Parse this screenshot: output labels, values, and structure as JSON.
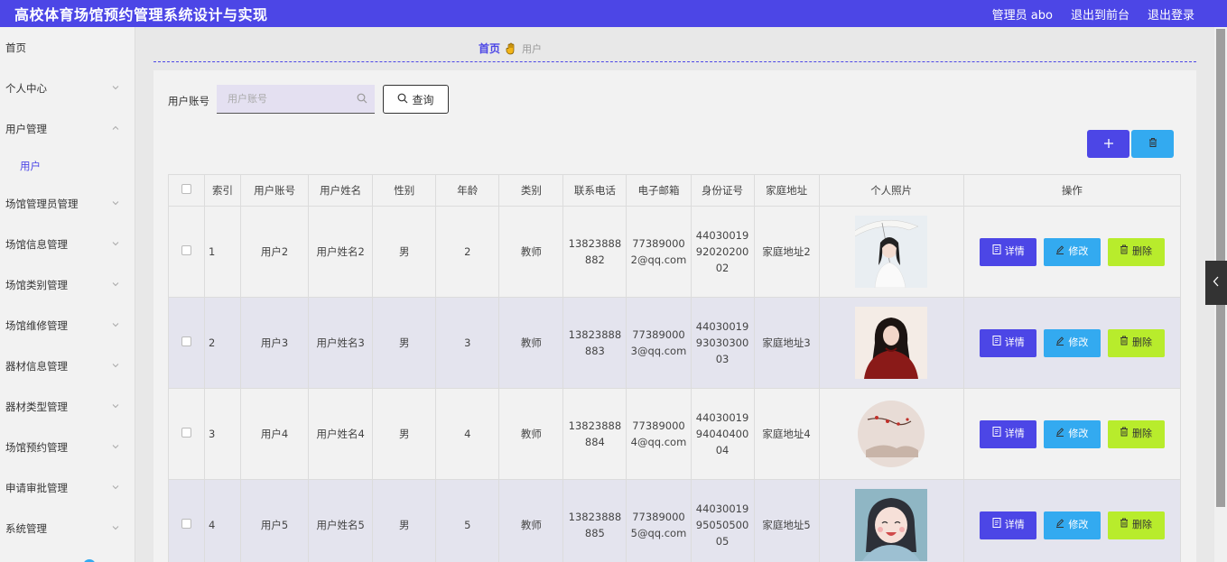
{
  "header": {
    "title": "高校体育场馆预约管理系统设计与实现",
    "admin": "管理员 abo",
    "back_to_front": "退出到前台",
    "logout": "退出登录"
  },
  "sidebar": {
    "items": [
      {
        "label": "首页",
        "expandable": false
      },
      {
        "label": "个人中心",
        "expandable": true
      },
      {
        "label": "用户管理",
        "expandable": true,
        "expanded": true,
        "sub": [
          "用户"
        ]
      },
      {
        "label": "场馆管理员管理",
        "expandable": true
      },
      {
        "label": "场馆信息管理",
        "expandable": true
      },
      {
        "label": "场馆类别管理",
        "expandable": true
      },
      {
        "label": "场馆维修管理",
        "expandable": true
      },
      {
        "label": "器材信息管理",
        "expandable": true
      },
      {
        "label": "器材类型管理",
        "expandable": true
      },
      {
        "label": "场馆预约管理",
        "expandable": true
      },
      {
        "label": "申请审批管理",
        "expandable": true
      },
      {
        "label": "系统管理",
        "expandable": true
      }
    ]
  },
  "breadcrumb": {
    "home": "首页",
    "current": "用户"
  },
  "search": {
    "label": "用户账号",
    "placeholder": "用户账号",
    "value": "",
    "button": "查询"
  },
  "table": {
    "headers": [
      "索引",
      "用户账号",
      "用户姓名",
      "性别",
      "年龄",
      "类别",
      "联系电话",
      "电子邮箱",
      "身份证号",
      "家庭地址",
      "个人照片",
      "操作"
    ],
    "rows": [
      {
        "index": "1",
        "account": "用户2",
        "name": "用户姓名2",
        "gender": "男",
        "age": "2",
        "category": "教师",
        "phone": "13823888882",
        "email": "773890002@qq.com",
        "id_no": "440300199202020002",
        "address": "家庭地址2",
        "photo": "photo-umbrella"
      },
      {
        "index": "2",
        "account": "用户3",
        "name": "用户姓名3",
        "gender": "男",
        "age": "3",
        "category": "教师",
        "phone": "13823888883",
        "email": "773890003@qq.com",
        "id_no": "440300199303030003",
        "address": "家庭地址3",
        "photo": "photo-red-dress"
      },
      {
        "index": "3",
        "account": "用户4",
        "name": "用户姓名4",
        "gender": "男",
        "age": "4",
        "category": "教师",
        "phone": "13823888884",
        "email": "773890004@qq.com",
        "id_no": "440300199404040004",
        "address": "家庭地址4",
        "photo": "photo-plum-blossom"
      },
      {
        "index": "4",
        "account": "用户5",
        "name": "用户姓名5",
        "gender": "男",
        "age": "5",
        "category": "教师",
        "phone": "13823888885",
        "email": "773890005@qq.com",
        "id_no": "440300199505050005",
        "address": "家庭地址5",
        "photo": "photo-cartoon-girl"
      }
    ],
    "actions": {
      "detail": "详情",
      "edit": "修改",
      "delete": "删除"
    }
  },
  "colors": {
    "primary": "#4c46e6",
    "info": "#33aaf0",
    "danger_lime": "#b8ec2c"
  }
}
